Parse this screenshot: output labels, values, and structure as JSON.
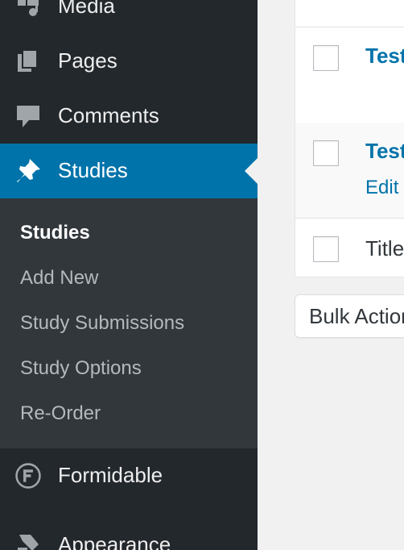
{
  "sidebar": {
    "items": [
      {
        "label": "Media",
        "icon": "media-icon"
      },
      {
        "label": "Pages",
        "icon": "pages-icon"
      },
      {
        "label": "Comments",
        "icon": "comments-icon"
      },
      {
        "label": "Studies",
        "icon": "pin-icon",
        "current": true
      },
      {
        "label": "Formidable",
        "icon": "formidable-icon"
      },
      {
        "label": "Appearance",
        "icon": "appearance-icon"
      }
    ],
    "submenu": [
      {
        "label": "Studies",
        "current": true
      },
      {
        "label": "Add New"
      },
      {
        "label": "Study Submissions"
      },
      {
        "label": "Study Options"
      },
      {
        "label": "Re-Order"
      }
    ]
  },
  "table": {
    "rows": [
      {
        "title": "Test"
      },
      {
        "title": "Test",
        "action": "Edit"
      }
    ],
    "footer_column": "Title"
  },
  "bulk_actions": {
    "selected": "Bulk Actions"
  },
  "colors": {
    "sidebar_bg": "#23282d",
    "submenu_bg": "#32373c",
    "accent": "#0073aa",
    "page_bg": "#f1f1f1"
  }
}
